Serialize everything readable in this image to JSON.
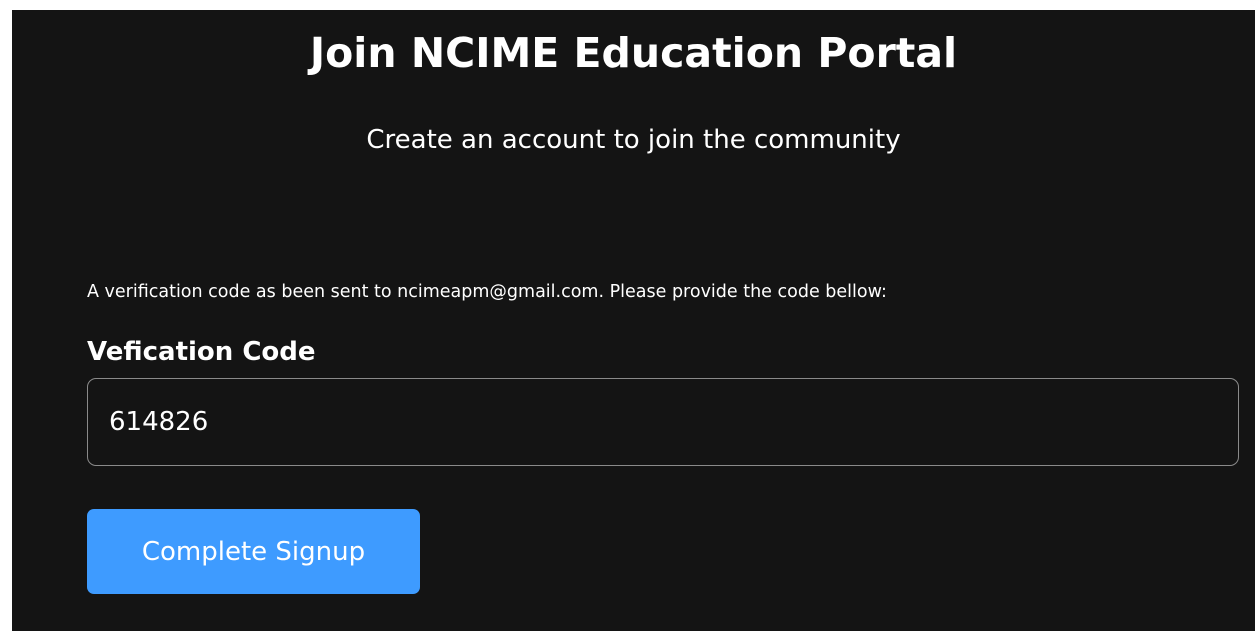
{
  "header": {
    "title": "Join NCIME Education Portal",
    "subtitle": "Create an account to join the community"
  },
  "verification": {
    "notice": "A verification code as been sent to ncimeapm@gmail.com. Please provide the code bellow:",
    "field_label": "Vefication Code",
    "code_value": "614826"
  },
  "actions": {
    "submit_label": "Complete Signup"
  },
  "colors": {
    "background": "#141414",
    "button": "#3e9bff",
    "input_border": "#8a8a8a",
    "text": "#ffffff"
  }
}
